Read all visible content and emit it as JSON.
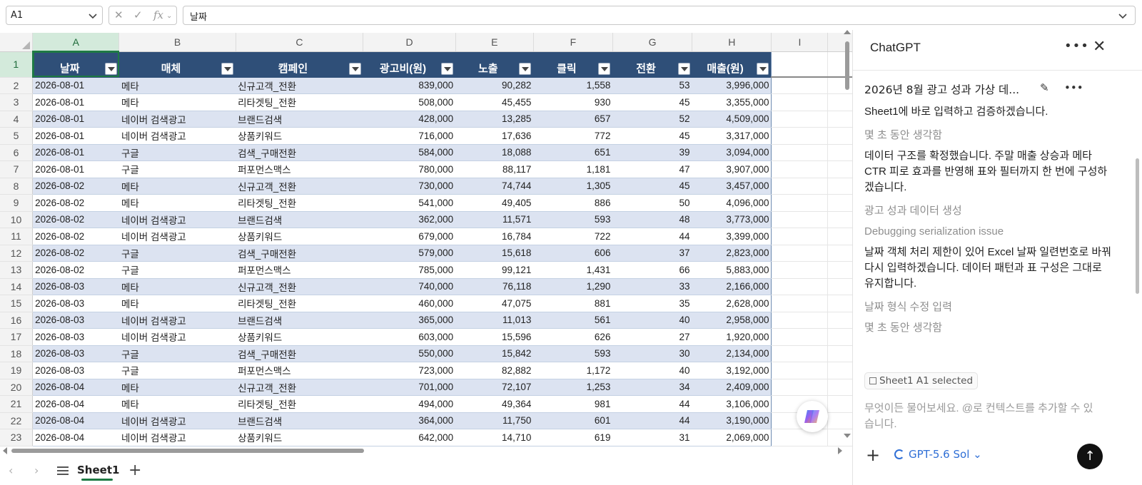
{
  "formula_bar": {
    "name_box": "A1",
    "formula": "날짜"
  },
  "grid": {
    "columns": [
      "A",
      "B",
      "C",
      "D",
      "E",
      "F",
      "G",
      "H",
      "I"
    ],
    "headers": [
      "날짜",
      "매체",
      "캠페인",
      "광고비(원)",
      "노출",
      "클릭",
      "전환",
      "매출(원)"
    ],
    "rows": [
      {
        "n": "2",
        "cells": [
          "2026-08-01",
          "메타",
          "신규고객_전환",
          "839,000",
          "90,282",
          "1,558",
          "53",
          "3,996,000"
        ]
      },
      {
        "n": "3",
        "cells": [
          "2026-08-01",
          "메타",
          "리타겟팅_전환",
          "508,000",
          "45,455",
          "930",
          "45",
          "3,355,000"
        ]
      },
      {
        "n": "4",
        "cells": [
          "2026-08-01",
          "네이버 검색광고",
          "브랜드검색",
          "428,000",
          "13,285",
          "657",
          "52",
          "4,509,000"
        ]
      },
      {
        "n": "5",
        "cells": [
          "2026-08-01",
          "네이버 검색광고",
          "상품키워드",
          "716,000",
          "17,636",
          "772",
          "45",
          "3,317,000"
        ]
      },
      {
        "n": "6",
        "cells": [
          "2026-08-01",
          "구글",
          "검색_구매전환",
          "584,000",
          "18,088",
          "651",
          "39",
          "3,094,000"
        ]
      },
      {
        "n": "7",
        "cells": [
          "2026-08-01",
          "구글",
          "퍼포먼스맥스",
          "780,000",
          "88,117",
          "1,181",
          "47",
          "3,907,000"
        ]
      },
      {
        "n": "8",
        "cells": [
          "2026-08-02",
          "메타",
          "신규고객_전환",
          "730,000",
          "74,744",
          "1,305",
          "45",
          "3,457,000"
        ]
      },
      {
        "n": "9",
        "cells": [
          "2026-08-02",
          "메타",
          "리타겟팅_전환",
          "541,000",
          "49,405",
          "886",
          "50",
          "4,096,000"
        ]
      },
      {
        "n": "10",
        "cells": [
          "2026-08-02",
          "네이버 검색광고",
          "브랜드검색",
          "362,000",
          "11,571",
          "593",
          "48",
          "3,773,000"
        ]
      },
      {
        "n": "11",
        "cells": [
          "2026-08-02",
          "네이버 검색광고",
          "상품키워드",
          "679,000",
          "16,784",
          "722",
          "44",
          "3,399,000"
        ]
      },
      {
        "n": "12",
        "cells": [
          "2026-08-02",
          "구글",
          "검색_구매전환",
          "579,000",
          "15,618",
          "606",
          "37",
          "2,823,000"
        ]
      },
      {
        "n": "13",
        "cells": [
          "2026-08-02",
          "구글",
          "퍼포먼스맥스",
          "785,000",
          "99,121",
          "1,431",
          "66",
          "5,883,000"
        ]
      },
      {
        "n": "14",
        "cells": [
          "2026-08-03",
          "메타",
          "신규고객_전환",
          "740,000",
          "76,118",
          "1,290",
          "33",
          "2,166,000"
        ]
      },
      {
        "n": "15",
        "cells": [
          "2026-08-03",
          "메타",
          "리타겟팅_전환",
          "460,000",
          "47,075",
          "881",
          "35",
          "2,628,000"
        ]
      },
      {
        "n": "16",
        "cells": [
          "2026-08-03",
          "네이버 검색광고",
          "브랜드검색",
          "365,000",
          "11,013",
          "561",
          "40",
          "2,958,000"
        ]
      },
      {
        "n": "17",
        "cells": [
          "2026-08-03",
          "네이버 검색광고",
          "상품키워드",
          "603,000",
          "15,596",
          "626",
          "27",
          "1,920,000"
        ]
      },
      {
        "n": "18",
        "cells": [
          "2026-08-03",
          "구글",
          "검색_구매전환",
          "550,000",
          "15,842",
          "593",
          "30",
          "2,134,000"
        ]
      },
      {
        "n": "19",
        "cells": [
          "2026-08-03",
          "구글",
          "퍼포먼스맥스",
          "723,000",
          "82,882",
          "1,172",
          "40",
          "3,192,000"
        ]
      },
      {
        "n": "20",
        "cells": [
          "2026-08-04",
          "메타",
          "신규고객_전환",
          "701,000",
          "72,107",
          "1,253",
          "34",
          "2,409,000"
        ]
      },
      {
        "n": "21",
        "cells": [
          "2026-08-04",
          "메타",
          "리타겟팅_전환",
          "494,000",
          "49,364",
          "981",
          "44",
          "3,106,000"
        ]
      },
      {
        "n": "22",
        "cells": [
          "2026-08-04",
          "네이버 검색광고",
          "브랜드검색",
          "364,000",
          "11,750",
          "601",
          "44",
          "3,190,000"
        ]
      },
      {
        "n": "23",
        "cells": [
          "2026-08-04",
          "네이버 검색광고",
          "상품키워드",
          "642,000",
          "14,710",
          "619",
          "31",
          "2,069,000"
        ]
      }
    ]
  },
  "tabs": {
    "active_sheet": "Sheet1",
    "add": "+"
  },
  "panel": {
    "title": "ChatGPT",
    "conversation_title": "2026년 8월 광고 성과 가상 데...",
    "messages": [
      {
        "kind": "msg",
        "text": "Sheet1에 바로 입력하고 검증하겠습니다."
      },
      {
        "kind": "status",
        "text": "몇 초 동안 생각함"
      },
      {
        "kind": "msg",
        "text": "데이터 구조를 확정했습니다. 주말 매출 상승과 메타 CTR 피로 효과를 반영해 표와 필터까지 한 번에 구성하겠습니다."
      },
      {
        "kind": "status",
        "text": "광고 성과 데이터 생성"
      },
      {
        "kind": "status",
        "text": "Debugging serialization issue"
      },
      {
        "kind": "msg",
        "text": "날짜 객체 처리 제한이 있어 Excel 날짜 일련번호로 바꿔 다시 입력하겠습니다. 데이터 패턴과 표 구성은 그대로 유지합니다."
      },
      {
        "kind": "status",
        "text": "날짜 형식 수정 입력"
      },
      {
        "kind": "status",
        "text": "몇 초 동안 생각함"
      }
    ],
    "context_chip": "Sheet1 A1 selected",
    "input_placeholder": "무엇이든 물어보세요. @로 컨텍스트를 추가할 수 있습니다.",
    "model": "GPT-5.6 Sol"
  },
  "colors": {
    "table_header": "#2f4f78",
    "band": "#dce3f1",
    "selection_green": "#1e7a44",
    "model_blue": "#2f6fd6"
  }
}
